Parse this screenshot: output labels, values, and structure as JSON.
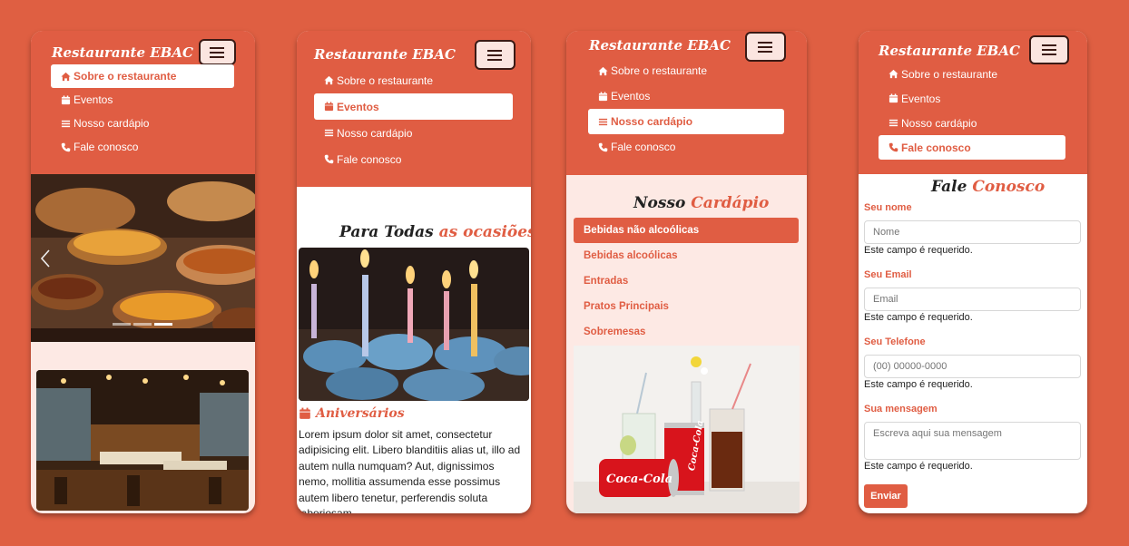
{
  "colors": {
    "accent": "#e05d43",
    "background": "#df5f42",
    "pink": "#fde9e4"
  },
  "brand": "Restaurante EBAC",
  "menu": {
    "about": "Sobre o restaurante",
    "events": "Eventos",
    "menu": "Nosso cardápio",
    "contact": "Fale conosco"
  },
  "events": {
    "title_a": "Para Todas",
    "title_b": "as ocasiões",
    "card_title": "Aniversários",
    "card_text": "Lorem ipsum dolor sit amet, consectetur adipisicing elit. Libero blanditiis alias ut, illo ad autem nulla numquam? Aut, dignissimos nemo, mollitia assumenda esse possimus autem libero tenetur, perferendis soluta laboriosam."
  },
  "cardapio": {
    "title_a": "Nosso",
    "title_b": "Cardápio",
    "categories": [
      "Bebidas não alcoólicas",
      "Bebidas alcoólicas",
      "Entradas",
      "Pratos Principais",
      "Sobremesas"
    ]
  },
  "contact": {
    "title_a": "Fale",
    "title_b": "Conosco",
    "name_label": "Seu nome",
    "name_placeholder": "Nome",
    "email_label": "Seu Email",
    "email_placeholder": "Email",
    "phone_label": "Seu Telefone",
    "phone_placeholder": "(00) 00000-0000",
    "message_label": "Sua mensagem",
    "message_placeholder": "Escreva aqui sua mensagem",
    "required": "Este campo é requerido.",
    "send": "Enviar"
  },
  "icons": [
    "home-icon",
    "calendar-icon",
    "list-icon",
    "phone-icon",
    "chevron-left-icon",
    "menu-icon"
  ]
}
